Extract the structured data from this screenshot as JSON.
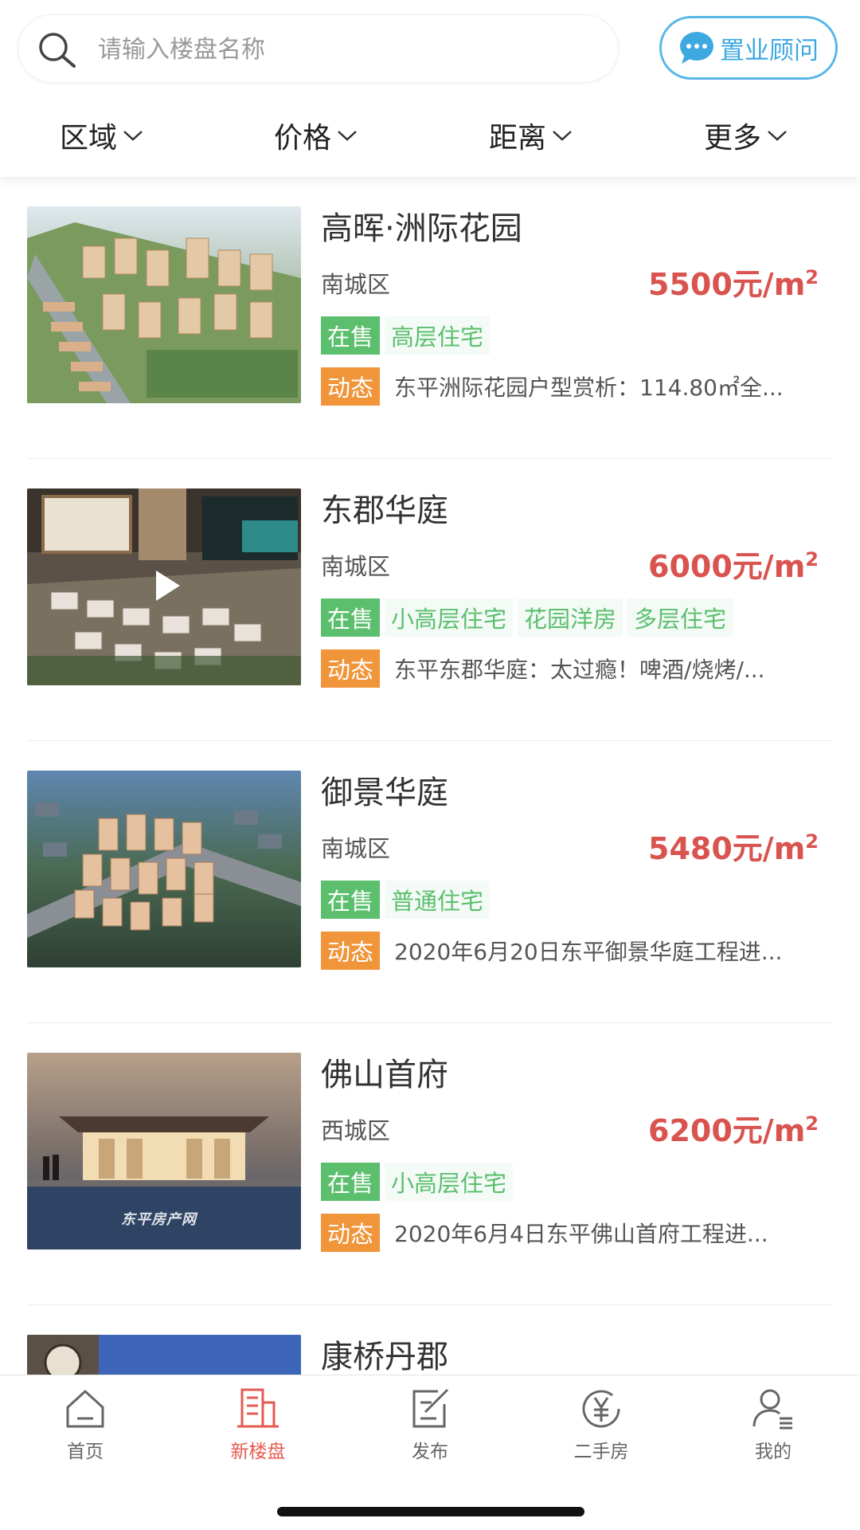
{
  "search": {
    "placeholder": "请输入楼盘名称"
  },
  "consultant": {
    "label": "置业顾问"
  },
  "filters": [
    {
      "label": "区域"
    },
    {
      "label": "价格"
    },
    {
      "label": "距离"
    },
    {
      "label": "更多"
    }
  ],
  "listings": [
    {
      "title": "高晖·洲际花园",
      "district": "南城区",
      "price": "5500元/m",
      "price_unit_sup": "2",
      "status": "在售",
      "types": [
        "高层住宅"
      ],
      "news_tag": "动态",
      "news": "东平洲际花园户型赏析：114.80㎡全..."
    },
    {
      "title": "东郡华庭",
      "district": "南城区",
      "price": "6000元/m",
      "price_unit_sup": "2",
      "status": "在售",
      "types": [
        "小高层住宅",
        "花园洋房",
        "多层住宅"
      ],
      "news_tag": "动态",
      "news": "东平东郡华庭：太过瘾！啤酒/烧烤/..."
    },
    {
      "title": "御景华庭",
      "district": "南城区",
      "price": "5480元/m",
      "price_unit_sup": "2",
      "status": "在售",
      "types": [
        "普通住宅"
      ],
      "news_tag": "动态",
      "news": "2020年6月20日东平御景华庭工程进..."
    },
    {
      "title": "佛山首府",
      "district": "西城区",
      "price": "6200元/m",
      "price_unit_sup": "2",
      "status": "在售",
      "types": [
        "小高层住宅"
      ],
      "news_tag": "动态",
      "news": "2020年6月4日东平佛山首府工程进..."
    },
    {
      "title": "康桥丹郡"
    }
  ],
  "image_watermark": "东平房产网",
  "tabbar": [
    {
      "label": "首页",
      "icon": "home-icon"
    },
    {
      "label": "新楼盘",
      "icon": "building-icon",
      "active": true
    },
    {
      "label": "发布",
      "icon": "edit-icon"
    },
    {
      "label": "二手房",
      "icon": "yuan-icon"
    },
    {
      "label": "我的",
      "icon": "user-icon"
    }
  ],
  "colors": {
    "price": "#d9534f",
    "sale_tag": "#5bbf6e",
    "news_tag": "#f0953a",
    "accent_blue": "#3ea8e0",
    "tab_active": "#e45a52"
  }
}
